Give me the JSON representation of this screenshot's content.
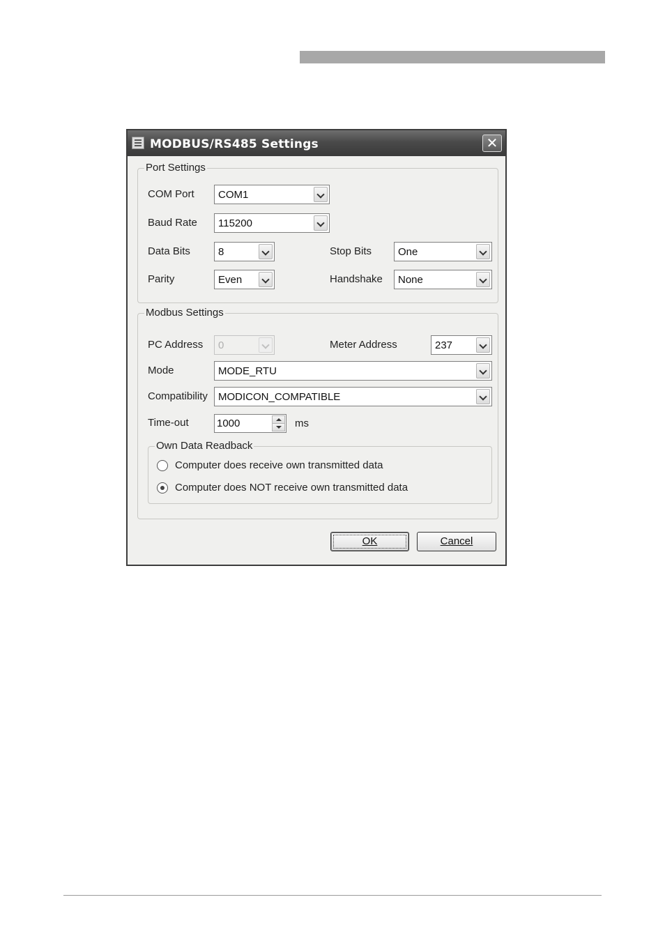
{
  "dialog": {
    "title": "MODBUS/RS485 Settings",
    "close_symbol": "✕"
  },
  "port_settings": {
    "legend": "Port Settings",
    "com_port": {
      "label": "COM Port",
      "value": "COM1"
    },
    "baud_rate": {
      "label": "Baud Rate",
      "value": "115200"
    },
    "data_bits": {
      "label": "Data Bits",
      "value": "8"
    },
    "stop_bits": {
      "label": "Stop Bits",
      "value": "One"
    },
    "parity": {
      "label": "Parity",
      "value": "Even"
    },
    "handshake": {
      "label": "Handshake",
      "value": "None"
    }
  },
  "modbus_settings": {
    "legend": "Modbus Settings",
    "pc_address": {
      "label": "PC Address",
      "value": "0",
      "enabled": false
    },
    "meter_address": {
      "label": "Meter Address",
      "value": "237"
    },
    "mode": {
      "label": "Mode",
      "value": "MODE_RTU"
    },
    "compatibility": {
      "label": "Compatibility",
      "value": "MODICON_COMPATIBLE"
    },
    "timeout": {
      "label": "Time-out",
      "value": "1000",
      "unit": "ms"
    },
    "readback": {
      "legend": "Own Data Readback",
      "options": [
        {
          "label": "Computer does receive own transmitted data",
          "selected": false
        },
        {
          "label": "Computer does NOT receive own transmitted data",
          "selected": true
        }
      ]
    }
  },
  "buttons": {
    "ok": "OK",
    "cancel": "Cancel"
  },
  "icons": {
    "app": "app-window-icon",
    "close": "close-icon",
    "dropdown": "chevron-down-icon",
    "spin_up": "spin-up-icon",
    "spin_down": "spin-down-icon"
  }
}
